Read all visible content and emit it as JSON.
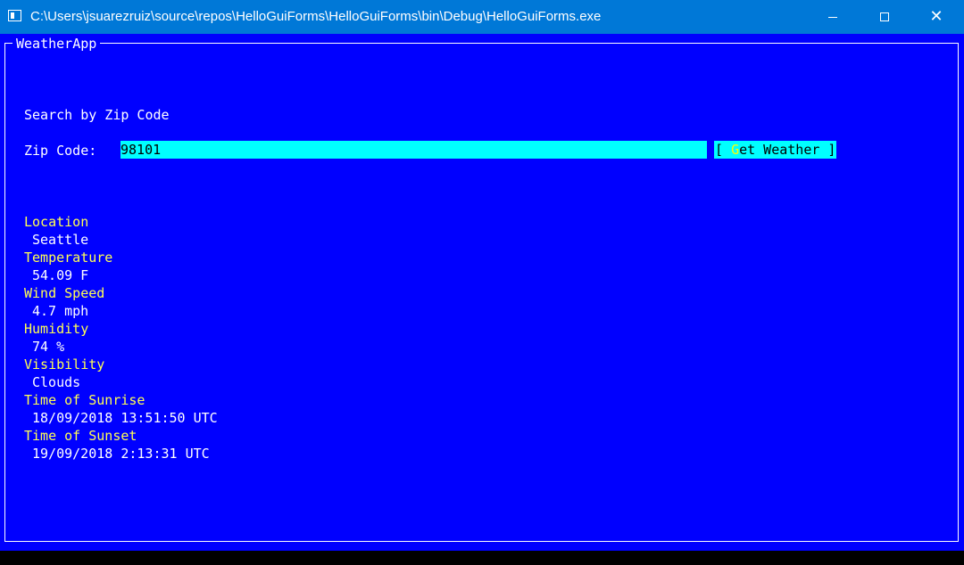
{
  "window": {
    "title": "C:\\Users\\jsuarezruiz\\source\\repos\\HelloGuiForms\\HelloGuiForms\\bin\\Debug\\HelloGuiForms.exe",
    "minimize_glyph": "",
    "close_glyph": "✕"
  },
  "app": {
    "frame_title": "WeatherApp",
    "search_heading": "Search by Zip Code",
    "zip_label": "Zip Code:",
    "zip_value": "98101",
    "button": {
      "bracket_left": "[ ",
      "hotkey": "G",
      "rest": "et Weather",
      "bracket_right": " ]"
    }
  },
  "results": [
    {
      "label": "Location",
      "value": "Seattle"
    },
    {
      "label": "Temperature",
      "value": "54.09 F"
    },
    {
      "label": "Wind Speed",
      "value": "4.7 mph"
    },
    {
      "label": "Humidity",
      "value": "74 %"
    },
    {
      "label": "Visibility",
      "value": "Clouds"
    },
    {
      "label": "Time of Sunrise",
      "value": "18/09/2018 13:51:50 UTC"
    },
    {
      "label": "Time of Sunset",
      "value": "19/09/2018 2:13:31 UTC"
    }
  ],
  "colors": {
    "titlebar": "#0078d7",
    "console_bg": "#0000ff",
    "label_yellow": "#ffff54",
    "field_cyan": "#00ffff"
  }
}
